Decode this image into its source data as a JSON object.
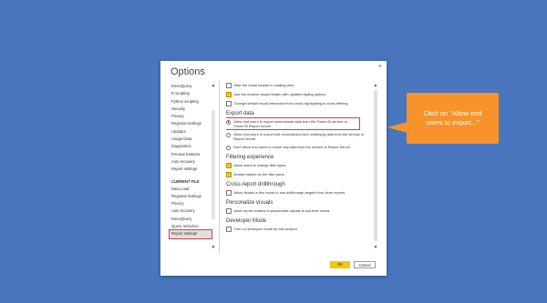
{
  "dialog": {
    "title": "Options",
    "close_symbol": "×",
    "ok_label": "OK",
    "cancel_label": "Cancel"
  },
  "sidebar": {
    "global_items": [
      "DirectQuery",
      "R scripting",
      "Python scripting",
      "Security",
      "Privacy",
      "Regional Settings",
      "Updates",
      "Usage Data",
      "Diagnostics",
      "Preview features",
      "Auto recovery",
      "Report settings"
    ],
    "current_file_heading": "CURRENT FILE",
    "current_file_items": [
      "Data Load",
      "Regional Settings",
      "Privacy",
      "Auto recovery",
      "DirectQuery",
      "Query reduction",
      "Report settings"
    ],
    "selected": "Report settings"
  },
  "content": {
    "top_options": [
      {
        "label": "Hide the visual header in reading view",
        "checked": false
      },
      {
        "label": "Use the modern visual header with updated styling options",
        "checked": true
      },
      {
        "label": "Change default visual interaction from cross highlighting to cross filtering",
        "checked": false
      }
    ],
    "export_heading": "Export data",
    "export_options": [
      {
        "label": "Allow end users to export summarized data from the Power BI service or Power BI Report Server",
        "selected": true
      },
      {
        "label": "Allow end users to export both summarized and underlying data from the service or Report Server",
        "selected": false
      },
      {
        "label": "Don't allow end users to export any data from the service or Report Server",
        "selected": false
      }
    ],
    "filtering_heading": "Filtering experience",
    "filtering_options": [
      {
        "label": "Allow users to change filter types",
        "checked": true
      },
      {
        "label": "Enable search for the filter pane",
        "checked": true
      }
    ],
    "drillthrough_heading": "Cross-report drillthrough",
    "drillthrough_options": [
      {
        "label": "Allow visuals in this report to use drillthrough targets from other reports",
        "checked": false
      }
    ],
    "personalize_heading": "Personalize visuals",
    "personalize_options": [
      {
        "label": "Allow report readers to personalize visuals to suit their needs",
        "checked": false
      }
    ],
    "developer_heading": "Developer Mode",
    "developer_options": [
      {
        "label": "Turn on developer mode for this session",
        "checked": false
      }
    ]
  },
  "callout": {
    "text": "Click on \"Allow end users to export...\""
  },
  "colors": {
    "background": "#4a76be",
    "accent_yellow": "#f2c811",
    "highlight_red": "#e03c31",
    "callout_orange": "#f7932a"
  }
}
